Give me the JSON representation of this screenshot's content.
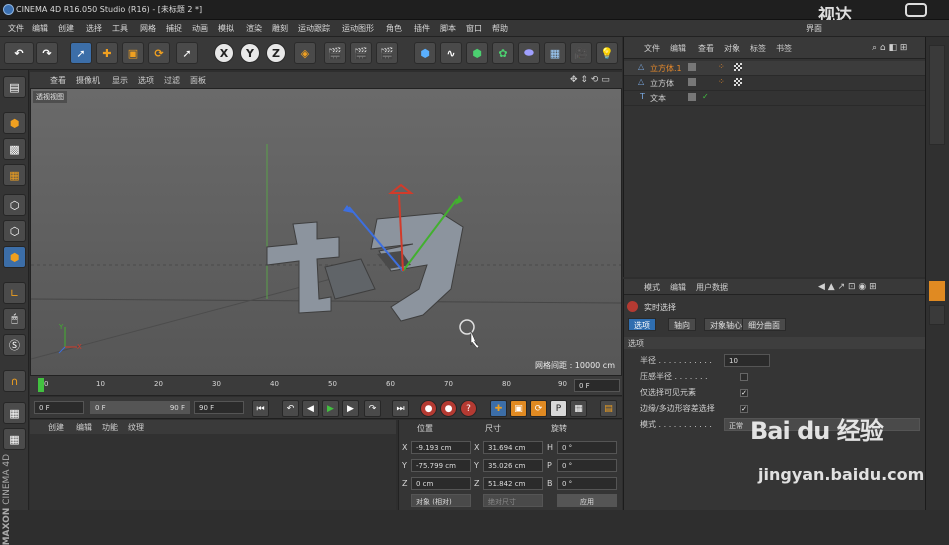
{
  "window": {
    "title": "CINEMA 4D R16.050 Studio (R16) - [未标题 2 *]"
  },
  "menu": [
    "文件",
    "编辑",
    "创建",
    "选择",
    "工具",
    "网格",
    "捕捉",
    "动画",
    "模拟",
    "渲染",
    "雕刻",
    "运动跟踪",
    "运动图形",
    "角色",
    "插件",
    "脚本",
    "窗口",
    "帮助"
  ],
  "layout_label": "界面",
  "toolbar": {
    "x_label": "X",
    "y_label": "Y",
    "z_label": "Z"
  },
  "viewport_menu": [
    "查看",
    "摄像机",
    "显示",
    "选项",
    "过滤",
    "面板"
  ],
  "viewport": {
    "label": "透视视图",
    "grid_spacing": "网格间距 : 10000 cm",
    "text_object": "七夕"
  },
  "timeline": {
    "ticks": [
      "0",
      "10",
      "20",
      "30",
      "40",
      "50",
      "60",
      "70",
      "80",
      "90"
    ],
    "current_frame": "0 F"
  },
  "transport": {
    "start": "0 F",
    "range_start": "0 F",
    "range_end": "90 F",
    "end": "90 F"
  },
  "materials": {
    "menu": [
      "创建",
      "编辑",
      "功能",
      "纹理"
    ]
  },
  "coordinates": {
    "headers": {
      "position": "位置",
      "size": "尺寸",
      "rotation": "旋转"
    },
    "rows": [
      {
        "axis": "X",
        "pos": "-9.193 cm",
        "size_axis": "X",
        "size": "31.694 cm",
        "rot_axis": "H",
        "rot": "0 °"
      },
      {
        "axis": "Y",
        "pos": "-75.799 cm",
        "size_axis": "Y",
        "size": "35.026 cm",
        "rot_axis": "P",
        "rot": "0 °"
      },
      {
        "axis": "Z",
        "pos": "0 cm",
        "size_axis": "Z",
        "size": "51.842 cm",
        "rot_axis": "B",
        "rot": "0 °"
      }
    ],
    "mode_select": "对象 (相对)",
    "size_select": "绝对尺寸",
    "apply": "应用"
  },
  "object_manager": {
    "menu": [
      "文件",
      "编辑",
      "查看",
      "对象",
      "标签",
      "书签"
    ],
    "objects": [
      {
        "name": "立方体.1",
        "color": "#e88a2a"
      },
      {
        "name": "立方体",
        "color": "#d0d0d0"
      },
      {
        "name": "文本",
        "color": "#d0d0d0"
      }
    ]
  },
  "attributes": {
    "menu": [
      "模式",
      "编辑",
      "用户数据"
    ],
    "title": "实时选择",
    "tabs": [
      "选项",
      "轴向",
      "对象轴心",
      "细分曲面"
    ],
    "section": "选项",
    "props": [
      {
        "label": "半径 . . . . . . . . . . .",
        "value": "10"
      },
      {
        "label": "压感半径 . . . . . . .",
        "value": ""
      },
      {
        "label": "仅选择可见元素",
        "value": "✓"
      },
      {
        "label": "边缘/多边形容差选择",
        "value": "✓"
      },
      {
        "label": "模式 . . . . . . . . . . .",
        "value": "正常"
      }
    ]
  },
  "watermark": {
    "top": "视达",
    "brand": "Bai du 经验",
    "url": "jingyan.baidu.com"
  },
  "brand": {
    "maxon": "MAXON",
    "product": "CINEMA 4D"
  },
  "colors": {
    "accent": "#2f6eb0",
    "axis_x": "#d23b2a",
    "axis_y": "#42b02f",
    "axis_z": "#3d6fe0"
  }
}
